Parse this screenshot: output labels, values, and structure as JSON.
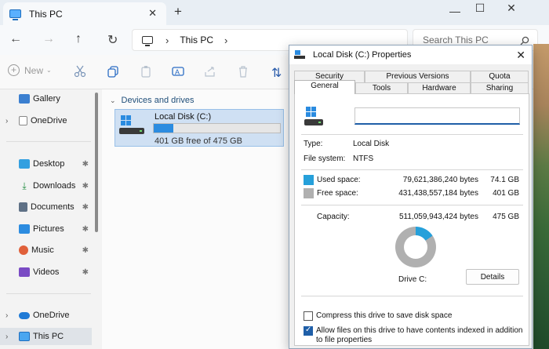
{
  "window": {
    "tab_title": "This PC",
    "tab_close": "✕",
    "new_tab": "+",
    "minimize": "—",
    "maximize": "☐",
    "close": "✕"
  },
  "navbar": {
    "back": "←",
    "forward": "→",
    "up": "↑",
    "refresh": "↻",
    "separator": "›",
    "breadcrumb": "This PC",
    "search_placeholder": "Search This PC"
  },
  "toolbar": {
    "new_label": "New",
    "new_caret": "⌄",
    "sort_icon": "⇅"
  },
  "sidebar": {
    "items": [
      {
        "label": "Gallery"
      },
      {
        "label": "OneDrive"
      },
      {
        "label": "Desktop"
      },
      {
        "label": "Downloads"
      },
      {
        "label": "Documents"
      },
      {
        "label": "Pictures"
      },
      {
        "label": "Music"
      },
      {
        "label": "Videos"
      },
      {
        "label": "OneDrive"
      },
      {
        "label": "This PC"
      }
    ],
    "pin": "📌",
    "chevron": "›"
  },
  "content": {
    "group_label": "Devices and drives",
    "group_chevron": "⌄",
    "drive": {
      "name": "Local Disk (C:)",
      "free_text": "401 GB free of 475 GB",
      "used_fraction": 0.156
    }
  },
  "dialog": {
    "title": "Local Disk (C:) Properties",
    "close": "✕",
    "tabs_row1": [
      "Security",
      "Previous Versions",
      "Quota"
    ],
    "tabs_row2": [
      "General",
      "Tools",
      "Hardware",
      "Sharing"
    ],
    "active_tab": "General",
    "name_value": "",
    "type_label": "Type:",
    "type_value": "Local Disk",
    "fs_label": "File system:",
    "fs_value": "NTFS",
    "used_label": "Used space:",
    "used_bytes": "79,621,386,240 bytes",
    "used_gb": "74.1 GB",
    "free_label": "Free space:",
    "free_bytes": "431,438,557,184 bytes",
    "free_gb": "401 GB",
    "capacity_label": "Capacity:",
    "capacity_bytes": "511,059,943,424 bytes",
    "capacity_gb": "475 GB",
    "drive_caption": "Drive C:",
    "details_button": "Details",
    "compress_label": "Compress this drive to save disk space",
    "compress_checked": false,
    "index_label": "Allow files on this drive to have contents indexed in addition to file properties",
    "index_checked": true,
    "used_color": "#26a0da",
    "free_color": "#b0b0b0",
    "used_fraction": 0.156
  }
}
